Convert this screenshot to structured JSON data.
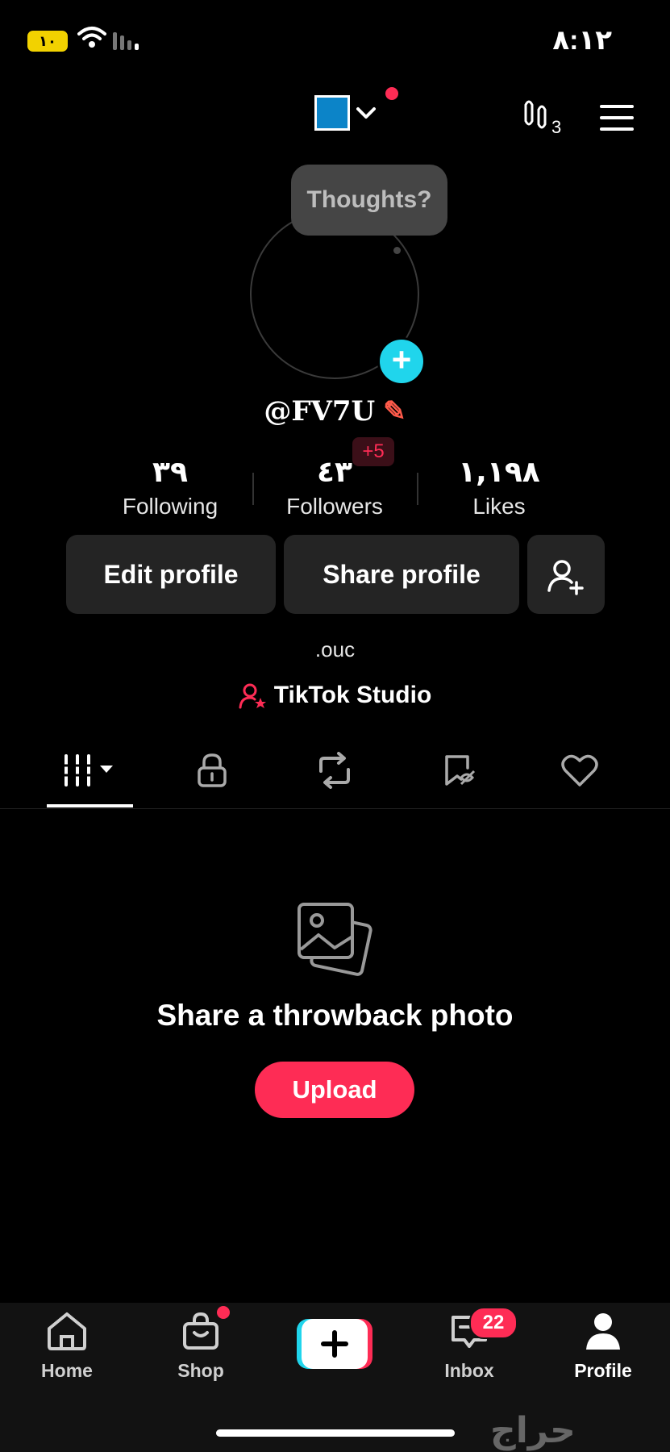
{
  "status_bar": {
    "time": "٨:١٢",
    "battery": "١٠"
  },
  "header": {
    "footprint_count": "3"
  },
  "profile": {
    "bubble_text": "Thoughts?",
    "username": "@FV7U",
    "bio": ".ouc",
    "studio_label": "TikTok Studio"
  },
  "stats": {
    "following": {
      "value": "٣٩",
      "label": "Following"
    },
    "followers": {
      "value": "٤٣",
      "label": "Followers",
      "new": "+5"
    },
    "likes": {
      "value": "١,١٩٨",
      "label": "Likes"
    }
  },
  "actions": {
    "edit": "Edit profile",
    "share": "Share profile"
  },
  "empty_state": {
    "title": "Share a throwback photo",
    "button": "Upload"
  },
  "nav": {
    "home": "Home",
    "shop": "Shop",
    "inbox": "Inbox",
    "inbox_badge": "22",
    "profile": "Profile"
  },
  "watermark": "حراج",
  "colors": {
    "accent": "#fe2c55",
    "cyan": "#20d5ec",
    "background": "#000000"
  }
}
